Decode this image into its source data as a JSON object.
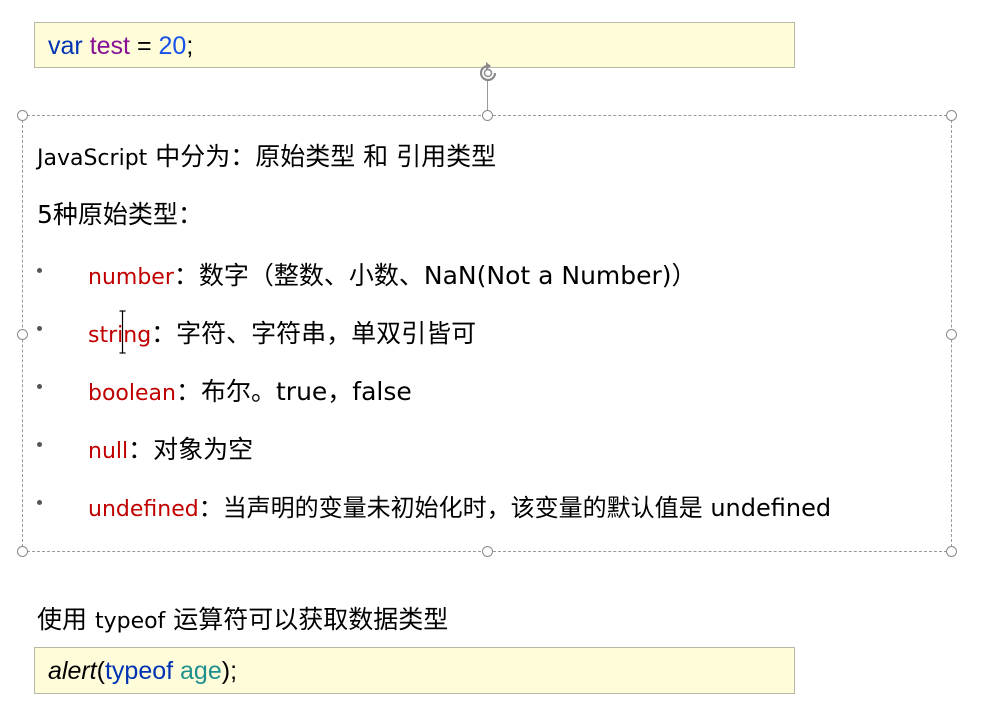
{
  "code1": {
    "keyword": "var",
    "identifier": "test",
    "operator": "=",
    "number": "20",
    "terminator": ";"
  },
  "heading1": {
    "latin": "JavaScript",
    "rest": " 中分为：原始类型 和 引用类型"
  },
  "heading2": "5种原始类型：",
  "bullets": [
    {
      "term": "number",
      "sep": "：",
      "desc": "数字（整数、小数、NaN(Not a Number)）"
    },
    {
      "term": "string",
      "sep": "：",
      "desc": "字符、字符串，单双引皆可"
    },
    {
      "term": "boolean",
      "sep": "：",
      "desc": "布尔。true，false"
    },
    {
      "term": "null",
      "sep": "：",
      "desc": "对象为空"
    },
    {
      "term": "undefined",
      "sep": "：",
      "desc": "当声明的变量未初始化时，该变量的默认值是 undefined"
    }
  ],
  "typeof_line": {
    "pre": "使用 ",
    "latin": "typeof",
    "post": " 运算符可以获取数据类型"
  },
  "code2": {
    "func": "alert",
    "open": "(",
    "keyword": "typeof",
    "space": " ",
    "arg": "age",
    "close": ");"
  },
  "icons": {
    "rotate": "rotate-handle-icon",
    "resize": "resize-handle-icon",
    "cursor": "text-cursor-icon"
  },
  "colors": {
    "code_background": "#fefcd9",
    "term_red": "#c00000",
    "keyword_blue": "#0033b3",
    "identifier_purple": "#871094"
  }
}
